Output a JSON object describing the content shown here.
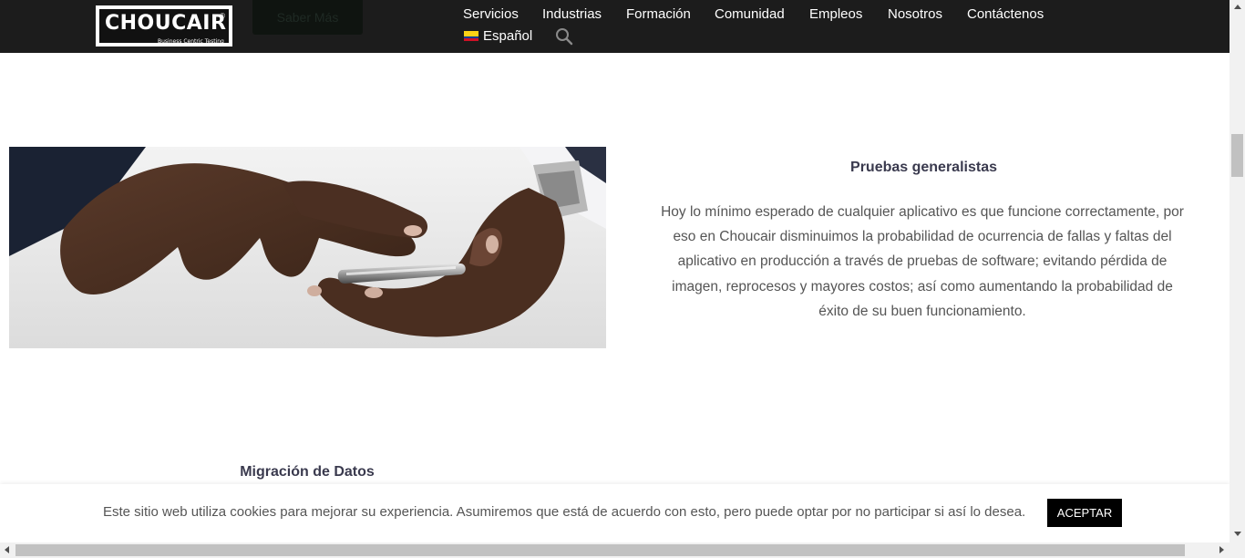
{
  "header": {
    "logo_text": "CHOUCAIR",
    "logo_tagline": "Business Centric Testing",
    "logo_reg": "®",
    "cta_label": "Saber Más",
    "nav": [
      {
        "label": "Servicios"
      },
      {
        "label": "Industrias"
      },
      {
        "label": "Formación"
      },
      {
        "label": "Comunidad"
      },
      {
        "label": "Empleos"
      },
      {
        "label": "Nosotros"
      },
      {
        "label": "Contáctenos"
      }
    ],
    "language": "Español",
    "search_icon": "search-icon",
    "flag_icon": "colombia-flag-icon"
  },
  "main": {
    "section_title": "Pruebas generalistas",
    "section_body": "Hoy lo mínimo esperado de cualquier aplicativo es que funcione correctamente, por eso en Choucair disminuimos la probabilidad de ocurrencia de fallas y faltas del aplicativo en producción a través de pruebas de software; evitando pérdida de imagen, reprocesos y mayores costos; así como aumentando la probabilidad de éxito de su buen funcionamiento.",
    "next_section_title": "Migración de Datos"
  },
  "cookie": {
    "message": "Este sitio web utiliza cookies para mejorar su experiencia. Asumiremos que está de acuerdo con esto, pero puede optar por no participar si así lo desea.",
    "accept_label": "ACEPTAR"
  },
  "colors": {
    "header_bg": "#1c1c1c",
    "title_color": "#3a3a4e",
    "button_bg": "#000000"
  }
}
